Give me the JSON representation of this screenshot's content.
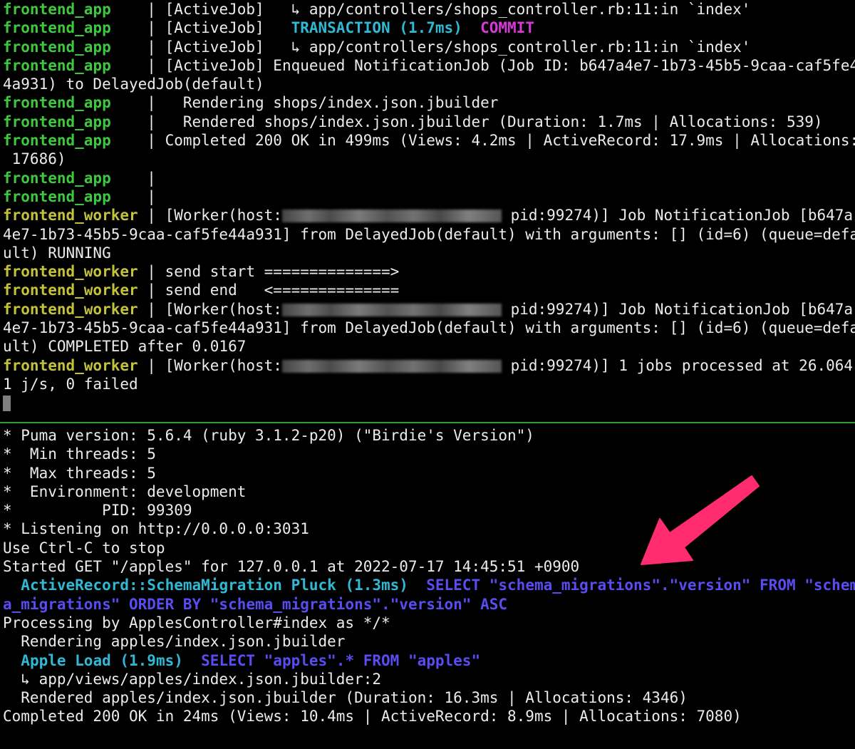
{
  "top_pane": {
    "line1": {
      "prefix": "frontend_app    ",
      "text": "| [ActiveJob]   ↳ app/controllers/shops_controller.rb:11:in `index'"
    },
    "line2": {
      "prefix": "frontend_app    ",
      "text": "| [ActiveJob]   ",
      "transaction": "TRANSACTION (1.7ms)",
      "commit": "COMMIT"
    },
    "line3": {
      "prefix": "frontend_app    ",
      "text": "| [ActiveJob]   ↳ app/controllers/shops_controller.rb:11:in `index'"
    },
    "line4": {
      "prefix": "frontend_app    ",
      "text": "| [ActiveJob] Enqueued NotificationJob (Job ID: b647a4e7-1b73-45b5-9caa-caf5fe4"
    },
    "line5": {
      "text": "4a931) to DelayedJob(default)"
    },
    "line6": {
      "prefix": "frontend_app    ",
      "text": "|   Rendering shops/index.json.jbuilder"
    },
    "line7": {
      "prefix": "frontend_app    ",
      "text": "|   Rendered shops/index.json.jbuilder (Duration: 1.7ms | Allocations: 539)"
    },
    "line8": {
      "prefix": "frontend_app    ",
      "text": "| Completed 200 OK in 499ms (Views: 4.2ms | ActiveRecord: 17.9ms | Allocations:"
    },
    "line9": {
      "text": " 17686)"
    },
    "line10": {
      "prefix": "frontend_app    ",
      "text": "|"
    },
    "line11": {
      "prefix": "frontend_app    ",
      "text": "|"
    },
    "line12": {
      "prefix": "frontend_worker ",
      "text_a": "| [Worker(host:",
      "text_b": " pid:99274)] Job NotificationJob [b647a"
    },
    "line13": {
      "text": "4e7-1b73-45b5-9caa-caf5fe44a931] from DelayedJob(default) with arguments: [] (id=6) (queue=defa"
    },
    "line14": {
      "text": "ult) RUNNING"
    },
    "line15": {
      "prefix": "frontend_worker ",
      "text": "| send start ==============>"
    },
    "line16": {
      "prefix": "frontend_worker ",
      "text": "| send end   <=============="
    },
    "line17": {
      "prefix": "frontend_worker ",
      "text_a": "| [Worker(host:",
      "text_b": " pid:99274)] Job NotificationJob [b647a"
    },
    "line18": {
      "text": "4e7-1b73-45b5-9caa-caf5fe44a931] from DelayedJob(default) with arguments: [] (id=6) (queue=defa"
    },
    "line19": {
      "text": "ult) COMPLETED after 0.0167"
    },
    "line20": {
      "prefix": "frontend_worker ",
      "text_a": "| [Worker(host:",
      "text_b": " pid:99274)] 1 jobs processed at 26.064"
    },
    "line21": {
      "text": "1 j/s, 0 failed"
    }
  },
  "bottom_pane": {
    "line1": "* Puma version: 5.6.4 (ruby 3.1.2-p20) (\"Birdie's Version\")",
    "line2": "*  Min threads: 5",
    "line3": "*  Max threads: 5",
    "line4": "*  Environment: development",
    "line5": "*          PID: 99309",
    "line6": "* Listening on http://0.0.0.0:3031",
    "line7": "Use Ctrl-C to stop",
    "line8": "Started GET \"/apples\" for 127.0.0.1 at 2022-07-17 14:45:51 +0900",
    "line9": {
      "indent": "  ",
      "label": "ActiveRecord::SchemaMigration Pluck (1.3ms)",
      "sql": "  SELECT \"schema_migrations\".\"version\" FROM \"schem"
    },
    "line10": "a_migrations\" ORDER BY \"schema_migrations\".\"version\" ASC",
    "line11": "Processing by ApplesController#index as */*",
    "line12": "  Rendering apples/index.json.jbuilder",
    "line13": {
      "indent": "  ",
      "label": "Apple Load (1.9ms)",
      "sql": "  SELECT \"apples\".* FROM \"apples\""
    },
    "line14": "  ↳ app/views/apples/index.json.jbuilder:2",
    "line15": "  Rendered apples/index.json.jbuilder (Duration: 16.3ms | Allocations: 4346)",
    "line16": "Completed 200 OK in 24ms (Views: 10.4ms | ActiveRecord: 8.9ms | Allocations: 7080)"
  },
  "colors": {
    "app_prefix": "#3fc83f",
    "worker_prefix": "#c3c23a",
    "cyan": "#31b8d3",
    "magenta": "#d63ad6",
    "sql_blue": "#5a4cf0",
    "divider": "#2f9e2f",
    "arrow": "#ff2d6f"
  },
  "annotation": {
    "icon": "arrow-icon"
  }
}
